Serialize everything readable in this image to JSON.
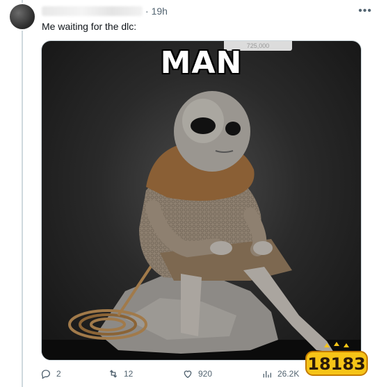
{
  "tweet": {
    "time": "19h",
    "more": "•••",
    "text": "Me waiting for the dlc:"
  },
  "media": {
    "caption": "MAN",
    "price_tag": "725,000"
  },
  "actions": {
    "replies": "2",
    "retweets": "12",
    "likes": "920",
    "views": "26.2K"
  },
  "watermark": {
    "text": "18183"
  },
  "colors": {
    "text_secondary": "#536471",
    "border": "#cfd9de",
    "watermark_yellow": "#f6c417"
  }
}
